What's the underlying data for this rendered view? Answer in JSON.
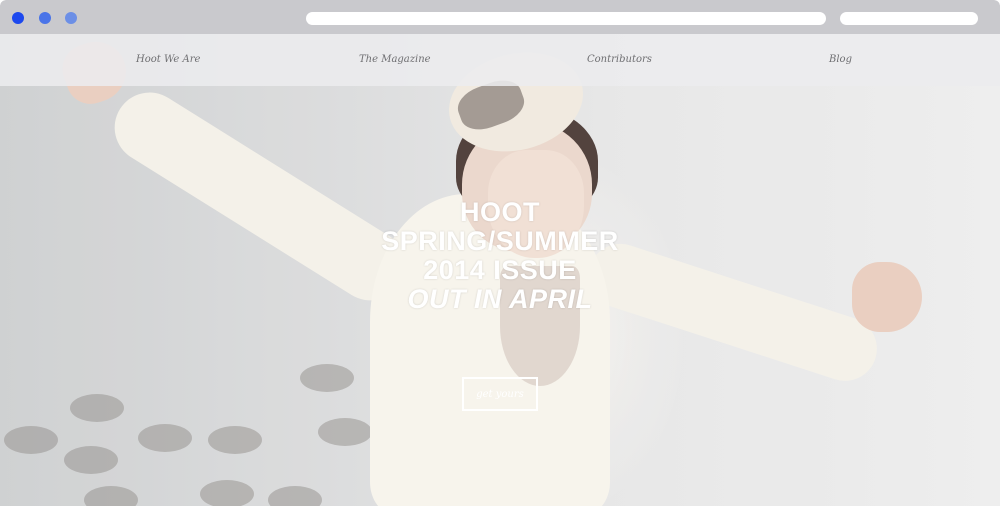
{
  "browser": {
    "dot_colors": [
      "#1c48ee",
      "#4a74e8",
      "#6c8fe6"
    ],
    "chrome_color": "#c9c9cd"
  },
  "nav": {
    "items": [
      {
        "label": "Hoot We Are"
      },
      {
        "label": "The Magazine"
      },
      {
        "label": "Contributors"
      },
      {
        "label": "Blog"
      }
    ]
  },
  "hero": {
    "headline_lines": [
      "HOOT",
      "SPRING/SUMMER",
      "2014 ISSUE",
      "OUT IN APRIL"
    ],
    "cta_label": "get yours",
    "text_color": "#ffffff"
  }
}
